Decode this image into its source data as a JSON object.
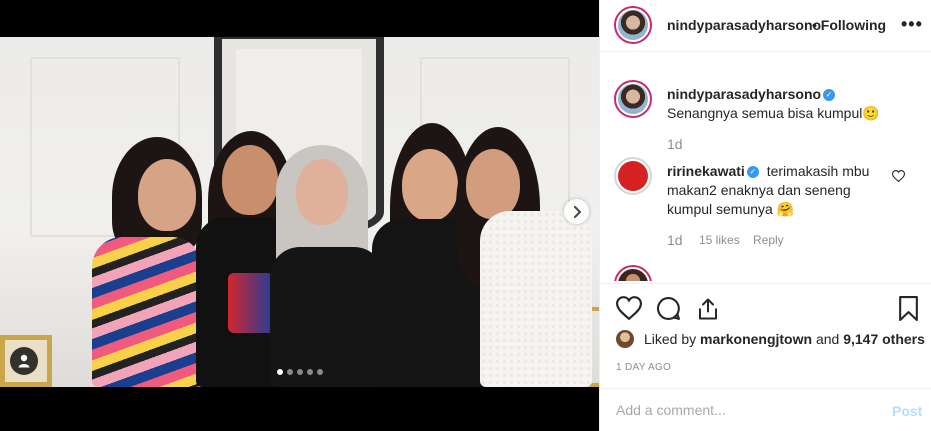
{
  "post": {
    "author": "nindyparasadyharsono",
    "follow_status": "• Following",
    "more_label": "•••",
    "carousel_total_dots": 5,
    "carousel_active_index": 0
  },
  "comments": [
    {
      "username": "nindyparasadyharsono",
      "verified": true,
      "text": "Senangnya semua bisa kumpul🙂",
      "age": "1d",
      "likes": "",
      "reply": ""
    },
    {
      "username": "ririnekawati",
      "verified": true,
      "text": "terimakasih mbu makan2 enaknya dan seneng kumpul semunya 🤗",
      "age": "1d",
      "likes": "15 likes",
      "reply": "Reply"
    }
  ],
  "likes": {
    "prefix": "Liked by ",
    "user": "markonengjtown",
    "suffix": " and 9,147 others"
  },
  "time_ago": "1 DAY AGO",
  "comment_box": {
    "placeholder": "Add a comment...",
    "post_label": "Post"
  },
  "colors": {
    "link_blue": "#3897f0",
    "post_disabled": "#b2dffc",
    "meta_gray": "#8e8e8e"
  }
}
